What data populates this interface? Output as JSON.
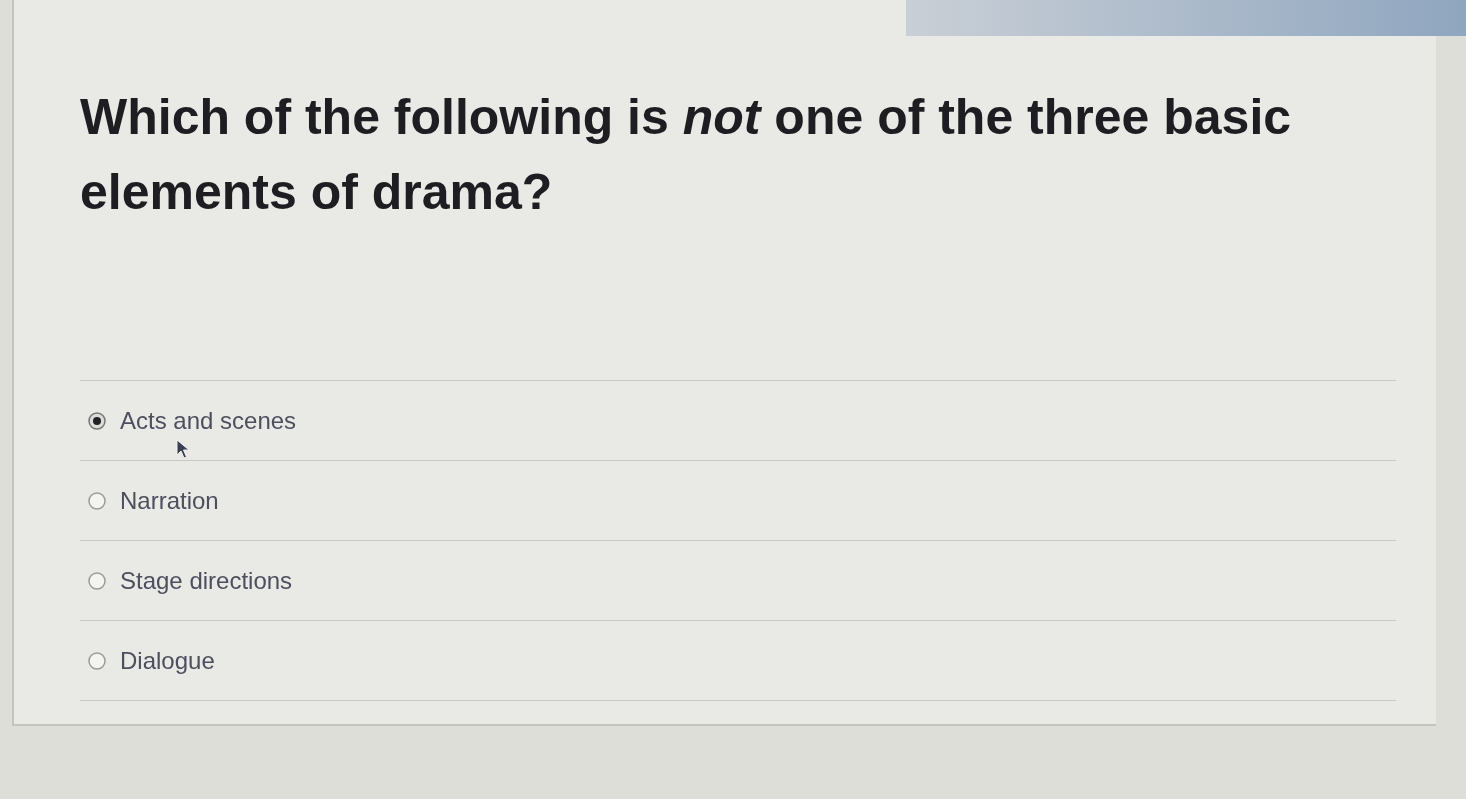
{
  "question": {
    "text": "Which of the following is *not* one of the three basic elements of drama?"
  },
  "options": [
    {
      "label": "Acts and scenes",
      "selected": true
    },
    {
      "label": "Narration",
      "selected": false
    },
    {
      "label": "Stage directions",
      "selected": false
    },
    {
      "label": "Dialogue",
      "selected": false
    }
  ]
}
